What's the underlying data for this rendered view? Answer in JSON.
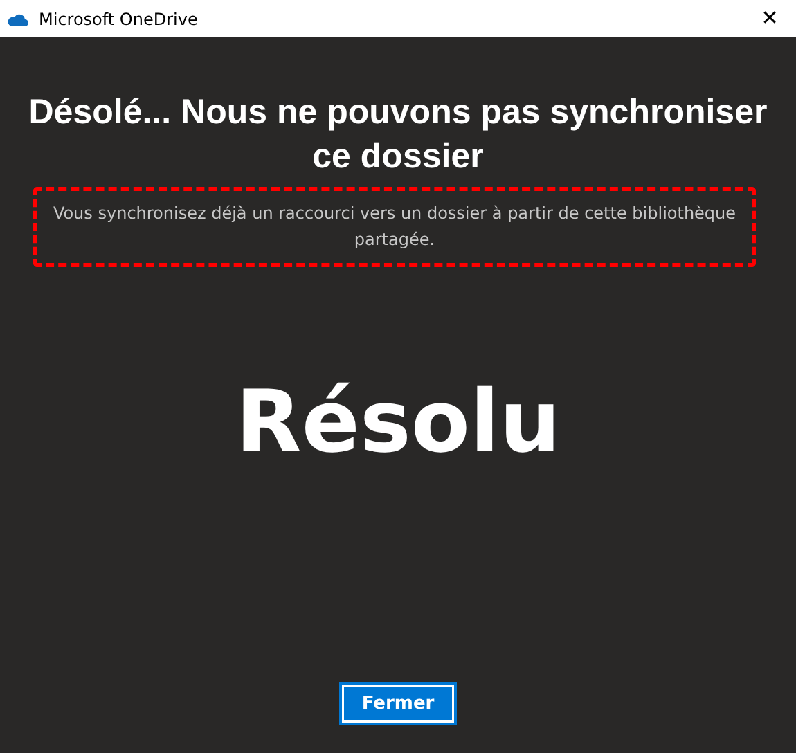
{
  "window": {
    "title": "Microsoft OneDrive",
    "close": "✕"
  },
  "heading": "Désolé... Nous ne pouvons pas synchroniser ce dossier",
  "message": "Vous synchronisez déjà un raccourci vers un dossier à partir de cette bibliothèque partagée.",
  "stamp": "Résolu",
  "buttons": [
    {
      "label": "Fermer"
    }
  ]
}
